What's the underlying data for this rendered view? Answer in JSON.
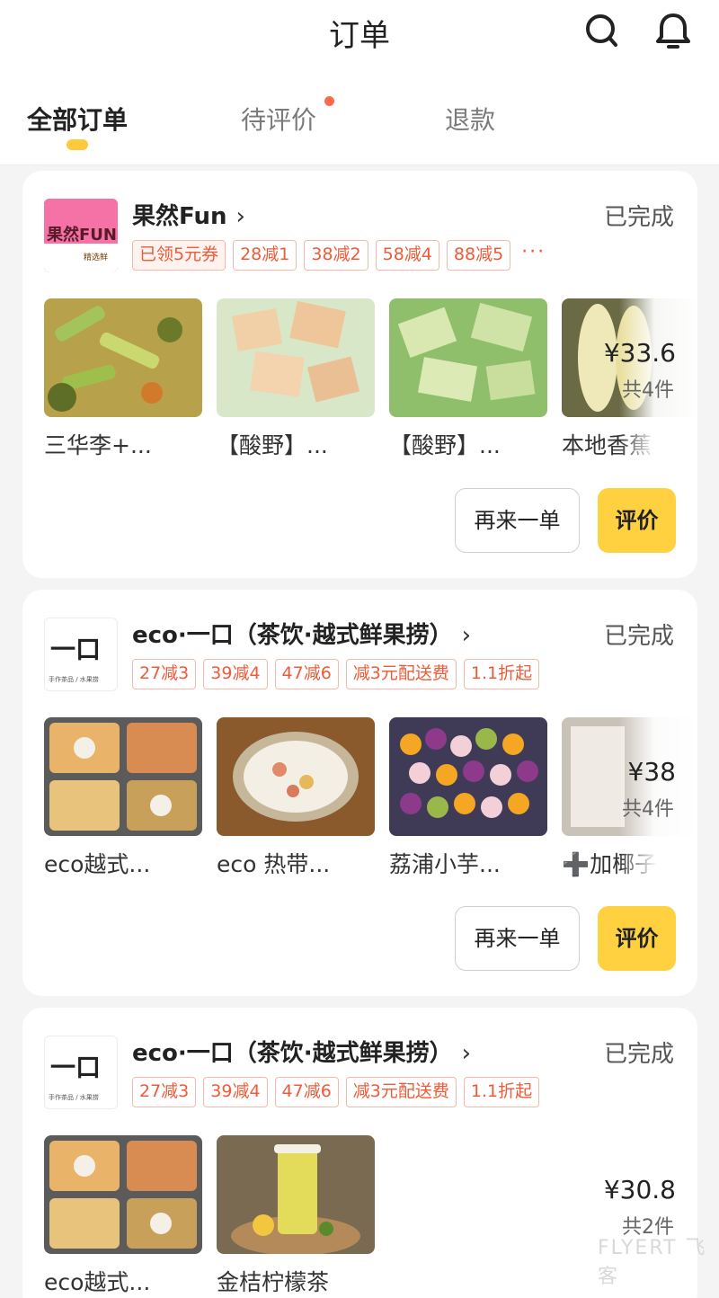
{
  "header": {
    "title": "订单"
  },
  "tabs": [
    {
      "label": "全部订单",
      "active": true
    },
    {
      "label": "待评价",
      "active": false,
      "dot": true
    },
    {
      "label": "退款",
      "active": false
    }
  ],
  "orders": [
    {
      "store": "果然Fun",
      "status": "已完成",
      "logo_text": "果然FUN",
      "logo_sub": "精选鲜",
      "tags": [
        "已领5元券",
        "28减1",
        "38减2",
        "58减4",
        "88减5"
      ],
      "tags_more": "···",
      "items": [
        "三华李+...",
        "【酸野】...",
        "【酸野】...",
        "本地香蕉"
      ],
      "price": "¥33.6",
      "count": "共4件",
      "again_label": "再来一单",
      "review_label": "评价"
    },
    {
      "store": "eco·一口（茶饮·越式鲜果捞）",
      "status": "已完成",
      "logo_text": "一口",
      "logo_sub": "手作茶品 / 水果捞",
      "tags": [
        "27减3",
        "39减4",
        "47减6",
        "减3元配送费",
        "1.1折起"
      ],
      "items": [
        "eco越式...",
        "eco 热带...",
        "荔浦小芋...",
        "➕加椰子"
      ],
      "price": "¥38",
      "count": "共4件",
      "again_label": "再来一单",
      "review_label": "评价"
    },
    {
      "store": "eco·一口（茶饮·越式鲜果捞）",
      "status": "已完成",
      "logo_text": "一口",
      "logo_sub": "手作茶品 / 水果捞",
      "tags": [
        "27减3",
        "39减4",
        "47减6",
        "减3元配送费",
        "1.1折起"
      ],
      "items": [
        "eco越式...",
        "金桔柠檬茶"
      ],
      "price": "¥30.8",
      "count": "共2件"
    }
  ],
  "watermark": "FLYERT 飞客",
  "colors": {
    "accent": "#ffd03f",
    "tag": "#ef5a38",
    "dot": "#ff6a4d"
  }
}
